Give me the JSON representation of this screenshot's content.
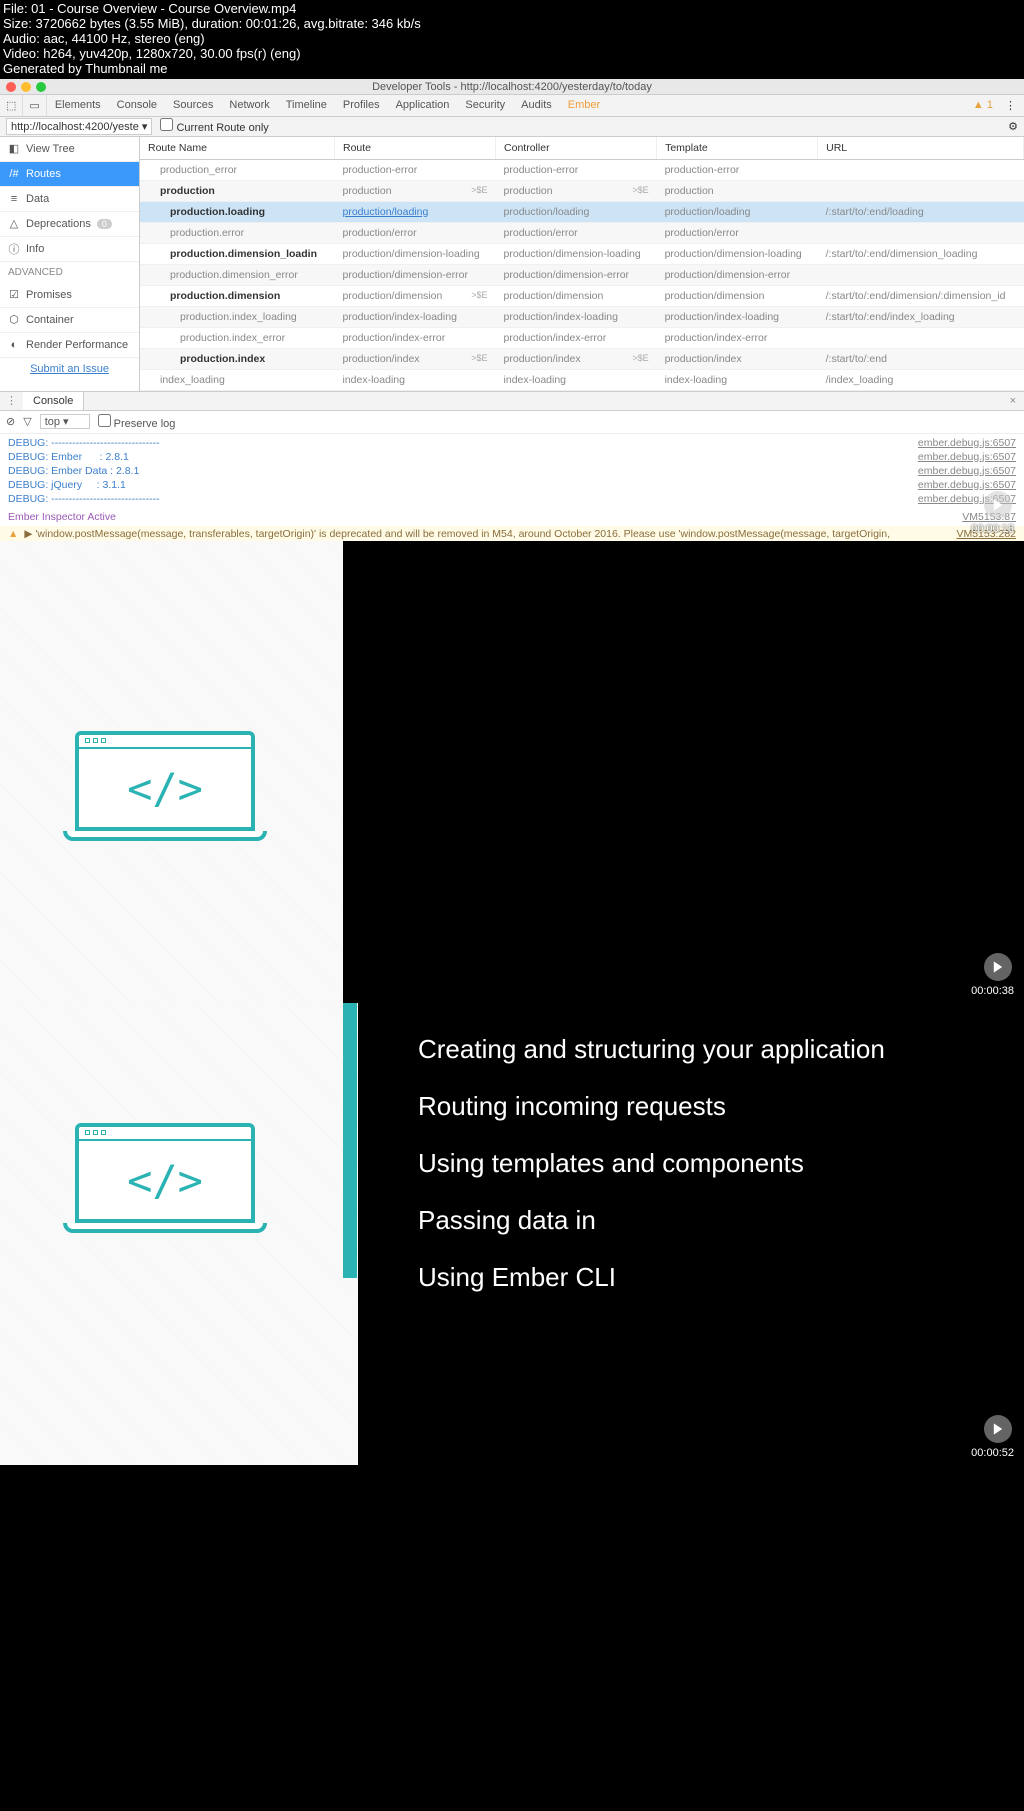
{
  "meta": {
    "file": "File: 01 - Course Overview - Course Overview.mp4",
    "size": "Size: 3720662 bytes (3.55 MiB), duration: 00:01:26, avg.bitrate: 346 kb/s",
    "audio": "Audio: aac, 44100 Hz, stereo (eng)",
    "video": "Video: h264, yuv420p, 1280x720, 30.00 fps(r) (eng)",
    "gen": "Generated by Thumbnail me"
  },
  "devtools": {
    "title": "Developer Tools - http://localhost:4200/yesterday/to/today",
    "tabs": [
      "Elements",
      "Console",
      "Sources",
      "Network",
      "Timeline",
      "Profiles",
      "Application",
      "Security",
      "Audits",
      "Ember"
    ],
    "active_tab": "Ember",
    "warn_count": "1",
    "url_select": "http://localhost:4200/yeste ▾",
    "current_route": "Current Route only",
    "sidebar": {
      "items": [
        {
          "icon": "tree",
          "label": "View Tree"
        },
        {
          "icon": "hash",
          "label": "Routes"
        },
        {
          "icon": "db",
          "label": "Data"
        },
        {
          "icon": "warn",
          "label": "Deprecations",
          "badge": "0"
        },
        {
          "icon": "info",
          "label": "Info"
        }
      ],
      "advanced_label": "ADVANCED",
      "advanced": [
        {
          "icon": "check",
          "label": "Promises"
        },
        {
          "icon": "box",
          "label": "Container"
        },
        {
          "icon": "gauge",
          "label": "Render Performance"
        }
      ],
      "submit": "Submit an Issue"
    },
    "table": {
      "headers": [
        "Route Name",
        "Route",
        "Controller",
        "Template",
        "URL"
      ],
      "rows": [
        {
          "d": 0,
          "name": "production_error",
          "route": "production-error",
          "ctrl": "production-error",
          "tmpl": "production-error",
          "url": ""
        },
        {
          "d": 0,
          "name": "production",
          "route": "production",
          "ctrl": "production",
          "tmpl": "production",
          "url": "",
          "bold": true,
          "dark": true,
          "marker": true,
          "marker2": true
        },
        {
          "d": 1,
          "name": "production.loading",
          "route": "production/loading",
          "ctrl": "production/loading",
          "tmpl": "production/loading",
          "url": "/:start/to/:end/loading",
          "bold": true,
          "sel": true,
          "link": true
        },
        {
          "d": 1,
          "name": "production.error",
          "route": "production/error",
          "ctrl": "production/error",
          "tmpl": "production/error",
          "url": "",
          "dark": true
        },
        {
          "d": 1,
          "name": "production.dimension_loadin",
          "route": "production/dimension-loading",
          "ctrl": "production/dimension-loading",
          "tmpl": "production/dimension-loading",
          "url": "/:start/to/:end/dimension_loading",
          "bold": true
        },
        {
          "d": 1,
          "name": "production.dimension_error",
          "route": "production/dimension-error",
          "ctrl": "production/dimension-error",
          "tmpl": "production/dimension-error",
          "url": "",
          "dark": true
        },
        {
          "d": 1,
          "name": "production.dimension",
          "route": "production/dimension",
          "ctrl": "production/dimension",
          "tmpl": "production/dimension",
          "url": "/:start/to/:end/dimension/:dimension_id",
          "bold": true,
          "marker": true
        },
        {
          "d": 2,
          "name": "production.index_loading",
          "route": "production/index-loading",
          "ctrl": "production/index-loading",
          "tmpl": "production/index-loading",
          "url": "/:start/to/:end/index_loading",
          "dark": true
        },
        {
          "d": 2,
          "name": "production.index_error",
          "route": "production/index-error",
          "ctrl": "production/index-error",
          "tmpl": "production/index-error",
          "url": ""
        },
        {
          "d": 2,
          "name": "production.index",
          "route": "production/index",
          "ctrl": "production/index",
          "tmpl": "production/index",
          "url": "/:start/to/:end",
          "bold": true,
          "dark": true,
          "marker": true,
          "marker2": true
        },
        {
          "d": 0,
          "name": "index_loading",
          "route": "index-loading",
          "ctrl": "index-loading",
          "tmpl": "index-loading",
          "url": "/index_loading"
        }
      ]
    },
    "console": {
      "tab": "Console",
      "top": "top",
      "preserve": "Preserve log",
      "lines": [
        {
          "l": "DEBUG: -------------------------------",
          "r": "ember.debug.js:6507"
        },
        {
          "l": "DEBUG: Ember      : 2.8.1",
          "r": "ember.debug.js:6507"
        },
        {
          "l": "DEBUG: Ember Data : 2.8.1",
          "r": "ember.debug.js:6507"
        },
        {
          "l": "DEBUG: jQuery     : 3.1.1",
          "r": "ember.debug.js:6507"
        },
        {
          "l": "DEBUG: -------------------------------",
          "r": "ember.debug.js:6507"
        }
      ],
      "active": "Ember Inspector Active",
      "active_r": "VM5153:87",
      "warn": "▶ 'window.postMessage(message, transferables, targetOrigin)' is deprecated and will be removed in M54, around October 2016. Please use 'window.postMessage(message, targetOrigin, transferables)' instead. See https://www.chromestatus.com/features/5719033043222528 for more details.",
      "warn_r": "VM5153:282"
    }
  },
  "thumb1": {
    "timestamp": "00:00:18"
  },
  "thumb2": {
    "timestamp": "00:00:38"
  },
  "thumb3": {
    "timestamp": "00:00:52",
    "bullets": [
      "Creating and structuring your application",
      "Routing incoming requests",
      "Using templates and components",
      "Passing data in",
      "Using Ember CLI"
    ]
  }
}
